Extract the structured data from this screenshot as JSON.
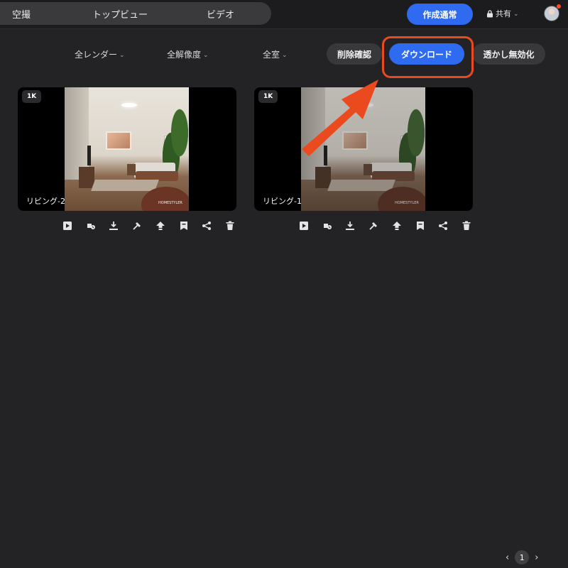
{
  "tabs": [
    {
      "label": "空撮"
    },
    {
      "label": "トップビュー"
    },
    {
      "label": "ビデオ"
    }
  ],
  "header": {
    "create_label": "作成通常",
    "share_label": "共有"
  },
  "filters": {
    "renders": "全レンダー",
    "resolution": "全解像度",
    "rooms": "全室"
  },
  "buttons": {
    "confirm_delete": "削除確認",
    "download": "ダウンロード",
    "disable_watermark": "透かし無効化"
  },
  "cards": [
    {
      "resolution": "1K",
      "label": "リビング-2"
    },
    {
      "resolution": "1K",
      "label": "リビング-1"
    }
  ],
  "actions": [
    "play-icon",
    "watermark-icon",
    "download-icon",
    "edit-icon",
    "upload-icon",
    "bookmark-icon",
    "share-icon",
    "delete-icon"
  ],
  "watermark_text": "HOMESTYLER",
  "pagination": {
    "current": "1",
    "prev": "‹",
    "next": "›"
  },
  "colors": {
    "accent": "#2f6bf0",
    "highlight": "#ea4a1e",
    "background": "#232325"
  }
}
